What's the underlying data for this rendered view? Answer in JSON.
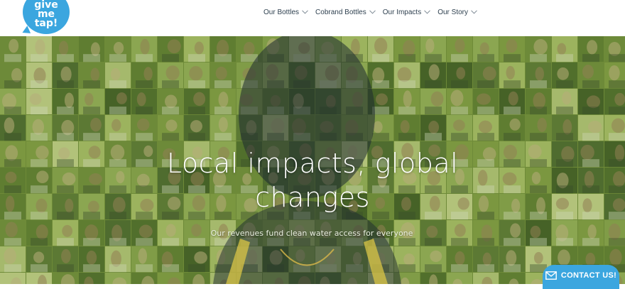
{
  "brand": {
    "logo_lines": [
      "give",
      "me",
      "tap!"
    ],
    "color": "#3ba6df"
  },
  "nav": {
    "items": [
      {
        "label": "Our Bottles",
        "icon": "chevron-down-icon"
      },
      {
        "label": "Cobrand Bottles",
        "icon": "chevron-down-icon"
      },
      {
        "label": "Our Impacts",
        "icon": "chevron-down-icon"
      },
      {
        "label": "Our Story",
        "icon": "chevron-down-icon"
      }
    ]
  },
  "hero": {
    "title_line1": "Local impacts, global",
    "title_line2": "changes",
    "subtitle": "Our revenues fund clean water access for everyone",
    "background": "photo mosaic of people with green tint forming a portrait"
  },
  "contact": {
    "label": "CONTACT US!",
    "icon": "envelope-icon"
  }
}
